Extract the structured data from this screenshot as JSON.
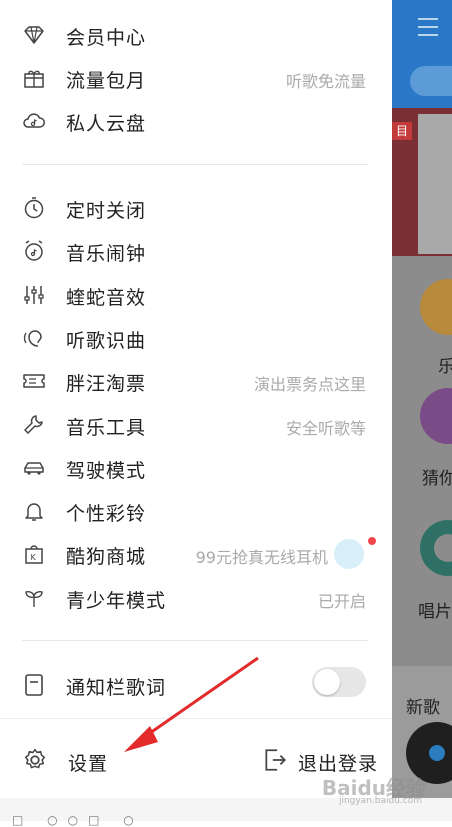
{
  "menu_top": [
    {
      "label": "会员中心",
      "sub": "",
      "icon": "diamond-icon"
    },
    {
      "label": "流量包月",
      "sub": "听歌免流量",
      "icon": "gift-icon"
    },
    {
      "label": "私人云盘",
      "sub": "",
      "icon": "cloud-music-icon"
    }
  ],
  "menu_mid": [
    {
      "label": "定时关闭",
      "sub": "",
      "icon": "timer-icon"
    },
    {
      "label": "音乐闹钟",
      "sub": "",
      "icon": "alarm-clock-icon"
    },
    {
      "label": "蝰蛇音效",
      "sub": "",
      "icon": "equalizer-icon"
    },
    {
      "label": "听歌识曲",
      "sub": "",
      "icon": "recognize-music-icon"
    },
    {
      "label": "胖汪淘票",
      "sub": "演出票务点这里",
      "icon": "ticket-icon"
    },
    {
      "label": "音乐工具",
      "sub": "安全听歌等",
      "icon": "wrench-icon"
    },
    {
      "label": "驾驶模式",
      "sub": "",
      "icon": "car-icon"
    },
    {
      "label": "个性彩铃",
      "sub": "",
      "icon": "bell-icon"
    },
    {
      "label": "酷狗商城",
      "sub": "99元抢真无线耳机",
      "icon": "shop-bag-icon"
    },
    {
      "label": "青少年模式",
      "sub": "已开启",
      "icon": "sprout-icon"
    }
  ],
  "notify": {
    "label": "通知栏歌词",
    "toggle_on": false,
    "icon": "lyrics-notification-icon"
  },
  "bottom": {
    "settings_label": "设置",
    "logout_label": "退出登录"
  },
  "background": {
    "banner_tag": "目",
    "item1": "乐",
    "item2": "猜你",
    "item3": "唱片",
    "tab": "新歌"
  },
  "watermark": {
    "main": "Baidu经验",
    "sub": "jingyan.baidu.com"
  },
  "colors": {
    "top_bar": "#2c78c8",
    "accent_dot": "#f0484a"
  }
}
